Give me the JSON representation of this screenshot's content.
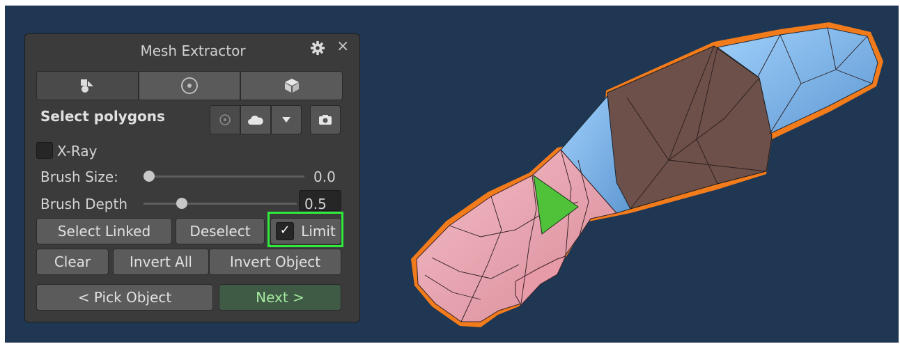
{
  "panel": {
    "title": "Mesh Extractor",
    "settings_icon": "gear-icon",
    "close_label": "×"
  },
  "tabs": [
    {
      "icon": "shapes-icon"
    },
    {
      "icon": "target-circle-icon"
    },
    {
      "icon": "cube-icon"
    }
  ],
  "selection": {
    "heading": "Select polygons",
    "tools": [
      "circle-select-icon",
      "cloud-icon",
      "dropdown-arrow-icon",
      "camera-icon"
    ]
  },
  "xray": {
    "label": "X-Ray",
    "checked": false
  },
  "brush_size": {
    "label": "Brush Size:",
    "value": "0.0",
    "fraction": 0.0
  },
  "brush_depth": {
    "label": "Brush Depth",
    "value": "0.5",
    "fraction": 0.25
  },
  "buttons": {
    "select_linked": "Select Linked",
    "deselect": "Deselect",
    "limit": "Limit",
    "limit_checked": true,
    "clear": "Clear",
    "invert_all": "Invert All",
    "invert_object": "Invert Object",
    "pick_object": "< Pick Object",
    "next": "Next >"
  },
  "colors": {
    "viewport_bg": "#1f3752",
    "panel_bg": "#3b3b3b",
    "highlight": "#2fe93c",
    "mesh_outline": "#f27b1b",
    "mesh_pink": "#e8a2ae",
    "mesh_blue": "#7fb5ea",
    "mesh_brown": "#6c5049",
    "selected_triangle": "#4fc23a"
  }
}
